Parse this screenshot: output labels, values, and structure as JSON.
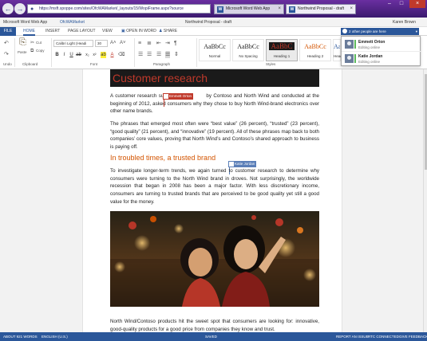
{
  "browser": {
    "address": "https://msft.spoppe.com/sites/OfcWAMarket/_layouts/15/WopiFrame.aspx?source",
    "tabs": [
      {
        "label": "Microsoft Word Web App"
      },
      {
        "label": "Northwind Proposal - draft"
      }
    ]
  },
  "titlebar": {
    "app_name": "Microsoft Word Web App",
    "site": "OfcWAMarket",
    "doc_title": "Northwind Proposal - draft",
    "user": "Karen Brown"
  },
  "ribbon_tabs": [
    {
      "label": "FILE"
    },
    {
      "label": "HOME"
    },
    {
      "label": "INSERT"
    },
    {
      "label": "PAGE LAYOUT"
    },
    {
      "label": "VIEW"
    },
    {
      "label": "OPEN IN WORD"
    },
    {
      "label": "SHARE"
    }
  ],
  "presence": {
    "badge": "2 other people are here",
    "people": [
      {
        "name": "Emmett Orton",
        "status": "Editing online"
      },
      {
        "name": "Katie Jordan",
        "status": "Editing online"
      }
    ]
  },
  "ribbon": {
    "undo": {
      "label": "Undo"
    },
    "clipboard": {
      "label": "Clipboard",
      "paste": "Paste",
      "cut": "Cut",
      "copy": "Copy"
    },
    "font": {
      "label": "Font",
      "family": "Calibri Light (Headi",
      "size": "30"
    },
    "paragraph": {
      "label": "Paragraph"
    },
    "styles": {
      "label": "Styles",
      "items": [
        {
          "sample": "AaBbCc",
          "name": "Normal"
        },
        {
          "sample": "AaBbCc",
          "name": "No Spacing"
        },
        {
          "sample": "AaBbC",
          "name": "Heading 1"
        },
        {
          "sample": "AaBbCc",
          "name": "Heading 2"
        },
        {
          "sample": "AaBbCc",
          "name": "Heading 3"
        }
      ]
    }
  },
  "document": {
    "heading": "Customer research",
    "p1a": "A customer research surv",
    "p1b": "by Contoso and North Wind and conducted at the beginning of 2012, asked consumers why they chose to buy North Wind-brand electronics over other name brands.",
    "p2": "The phrases that emerged most often were “best value” (26 percent), “trusted” (23 percent), “good quality” (21 percent), and “innovative” (19 percent). All of these phrases map back to both companies’ core values, proving that North Wind’s and Contoso’s shared approach to business is paying off.",
    "subheading": "In troubled times, a trusted brand",
    "p3": "To investigate longer-term trends, we again turned to customer research to determine why consumers were turning to the North Wind brand in droves. Not surprisingly, the worldwide recession that began in 2008 has been a major factor. With less discretionary income, consumers are turning to trusted brands that are perceived to be good quality yet still a good value for the money.",
    "p4": "North Wind/Contoso products hit the sweet spot that consumers are looking for: innovative, good-quality products for a good price from companies they know and trust.",
    "flags": [
      {
        "name": "Emmett Orton",
        "color": "#c0392b"
      },
      {
        "name": "Katie Jordan",
        "color": "#5b7fb8"
      }
    ]
  },
  "statusbar": {
    "words": "ABOUT 921 WORDS",
    "language": "ENGLISH (U.S.)",
    "saved": "SAVED",
    "report": "REPORT AN ISSUE",
    "connected": "RTC CONNECTED",
    "feedback": "GIVE FEEDBACK"
  },
  "colors": {
    "brand": "#2b579a",
    "browser_purple": "#5a2a8e",
    "heading_red": "#c0392b",
    "subheading_orange": "#d35400"
  }
}
